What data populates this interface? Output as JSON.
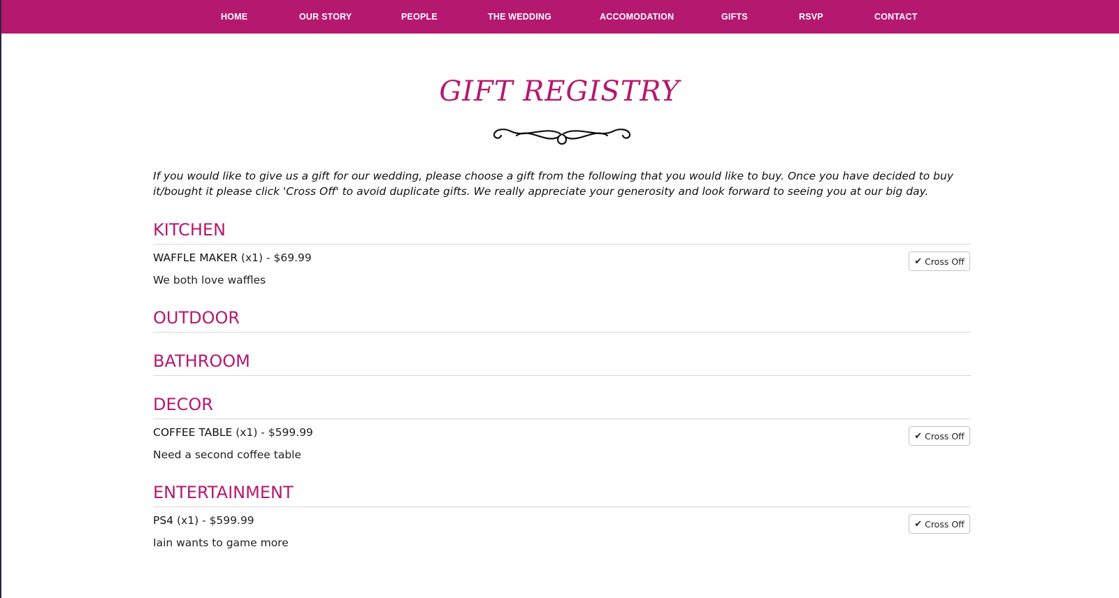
{
  "nav": {
    "items": [
      {
        "label": "HOME"
      },
      {
        "label": "OUR STORY"
      },
      {
        "label": "PEOPLE"
      },
      {
        "label": "THE WEDDING"
      },
      {
        "label": "ACCOMODATION"
      },
      {
        "label": "GIFTS"
      },
      {
        "label": "RSVP"
      },
      {
        "label": "CONTACT"
      }
    ]
  },
  "header": {
    "title": "GIFT REGISTRY"
  },
  "intro": "If you would like to give us a gift for our wedding, please choose a gift from the following that you would like to buy. Once you have decided to buy it/bought it please click 'Cross Off' to avoid duplicate gifts. We really appreciate your generosity and look forward to seeing you at our big day.",
  "sections": [
    {
      "title": "KITCHEN",
      "items": [
        {
          "name": "WAFFLE MAKER",
          "detail": "(x1) - $69.99",
          "description": "We both love waffles",
          "button": "Cross Off"
        }
      ]
    },
    {
      "title": "OUTDOOR",
      "items": []
    },
    {
      "title": "BATHROOM",
      "items": []
    },
    {
      "title": "DECOR",
      "items": [
        {
          "name": "COFFEE TABLE",
          "detail": "(x1) - $599.99",
          "description": "Need a second coffee table",
          "button": "Cross Off"
        }
      ]
    },
    {
      "title": "ENTERTAINMENT",
      "items": [
        {
          "name": "PS4",
          "detail": "(x1) - $599.99",
          "description": "Iain wants to game more",
          "button": "Cross Off"
        }
      ]
    }
  ],
  "colors": {
    "accent": "#b5186f",
    "text": "#1a1a1a",
    "rule": "#d6d6d6"
  },
  "icons": {
    "cross_off": "check-icon"
  }
}
